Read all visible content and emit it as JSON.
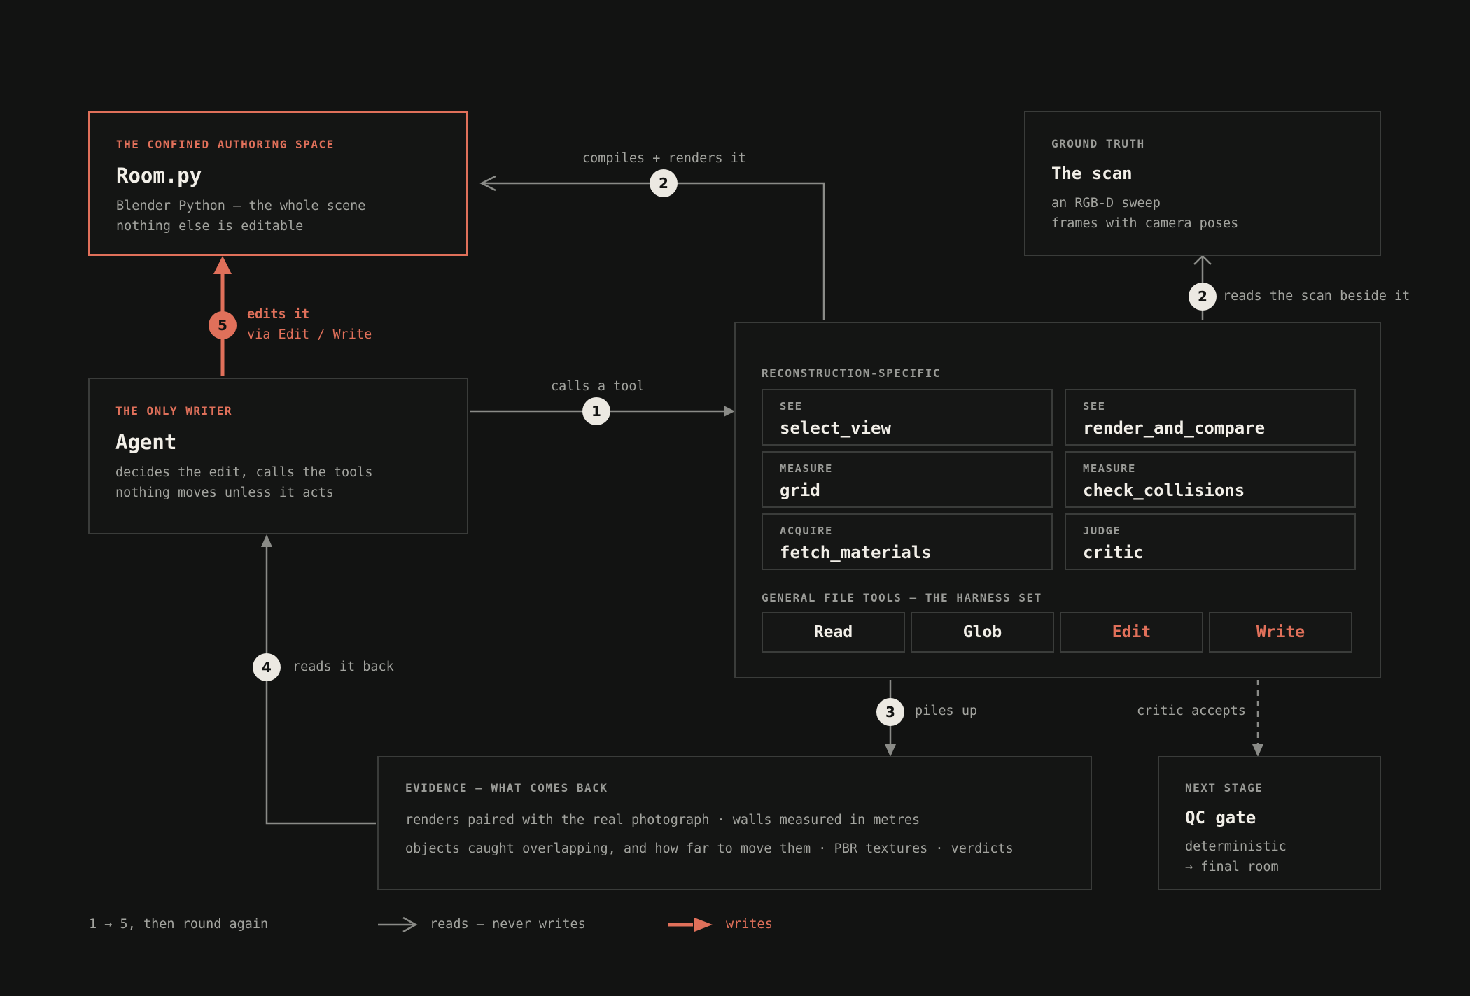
{
  "room": {
    "kicker": "THE CONFINED AUTHORING SPACE",
    "title": "Room.py",
    "line1": "Blender Python — the whole scene",
    "line2": "nothing else is editable"
  },
  "scan": {
    "kicker": "GROUND TRUTH",
    "title": "The scan",
    "line1": "an RGB-D sweep",
    "line2": "frames with camera poses"
  },
  "agent": {
    "kicker": "THE ONLY WRITER",
    "title": "Agent",
    "line1": "decides the edit, calls the tools",
    "line2": "nothing moves unless it acts"
  },
  "tools_panel": {
    "section1": "RECONSTRUCTION-SPECIFIC",
    "tools": [
      {
        "category": "SEE",
        "name": "select_view"
      },
      {
        "category": "SEE",
        "name": "render_and_compare"
      },
      {
        "category": "MEASURE",
        "name": "grid"
      },
      {
        "category": "MEASURE",
        "name": "check_collisions"
      },
      {
        "category": "ACQUIRE",
        "name": "fetch_materials"
      },
      {
        "category": "JUDGE",
        "name": "critic"
      }
    ],
    "section2": "GENERAL FILE TOOLS — THE HARNESS SET",
    "file_tools": [
      {
        "name": "Read",
        "writes": false
      },
      {
        "name": "Glob",
        "writes": false
      },
      {
        "name": "Edit",
        "writes": true
      },
      {
        "name": "Write",
        "writes": true
      }
    ]
  },
  "evidence": {
    "kicker": "EVIDENCE — WHAT COMES BACK",
    "line1": "renders paired with the real photograph · walls measured in metres",
    "line2": "objects caught overlapping, and how far to move them · PBR textures · verdicts"
  },
  "qc": {
    "kicker": "NEXT STAGE",
    "title": "QC gate",
    "line1": "deterministic",
    "line2": "→ final room"
  },
  "edges": {
    "compiles": "compiles + renders it",
    "reads_scan": "reads the scan beside it",
    "edits": "edits it",
    "edits_sub": "via Edit / Write",
    "calls": "calls a tool",
    "reads_back": "reads it back",
    "piles": "piles up",
    "critic": "critic accepts"
  },
  "badges": {
    "b1": "1",
    "b2a": "2",
    "b2b": "2",
    "b3": "3",
    "b4": "4",
    "b5": "5"
  },
  "legend": {
    "cycle": "1 → 5, then round again",
    "reads": "reads — never writes",
    "writes": "writes"
  },
  "colors": {
    "accent": "#e0705a",
    "background": "#121312",
    "border": "#3a3c3a",
    "line": "#8a8b87"
  }
}
